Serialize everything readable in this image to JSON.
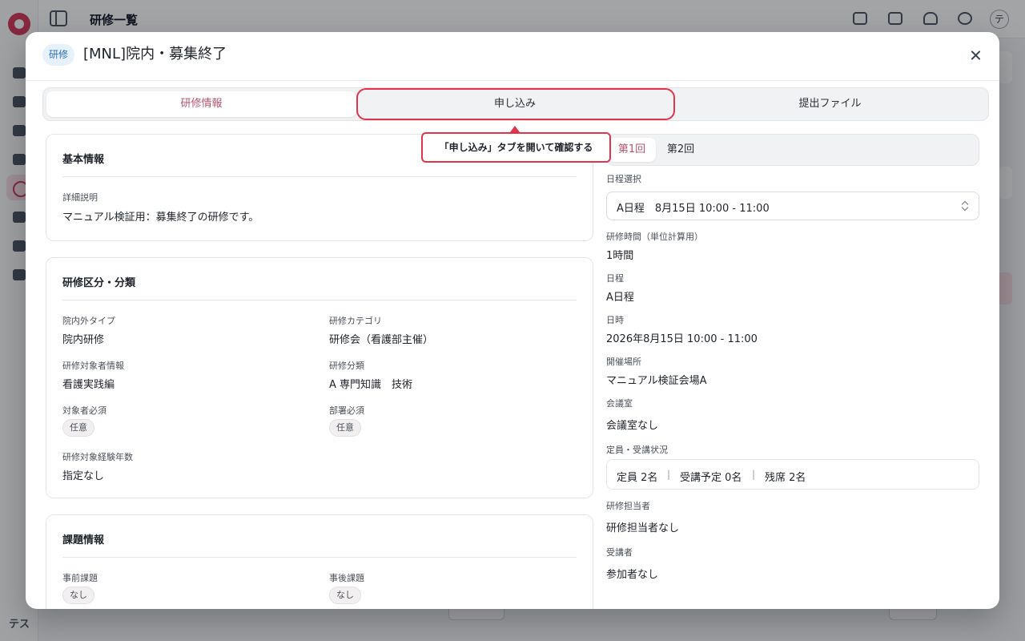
{
  "background": {
    "page_title": "研修一覧",
    "avatar_initial": "テ",
    "footer_label": "テス"
  },
  "modal": {
    "badge": "研修",
    "title": "[MNL]院内・募集終了",
    "tabs": [
      "研修情報",
      "申し込み",
      "提出ファイル"
    ],
    "active_tab": "研修情報",
    "tooltip": "「申し込み」タブを開いて確認する"
  },
  "basic_info": {
    "title": "基本情報",
    "description_label": "詳細説明",
    "description": "マニュアル検証用：募集終了の研修です。"
  },
  "classification": {
    "title": "研修区分・分類",
    "inout_type_label": "院内外タイプ",
    "inout_type": "院内研修",
    "category_label": "研修カテゴリ",
    "category": "研修会（看護部主催）",
    "target_info_label": "研修対象者情報",
    "target_info": "看護実践編",
    "classification_label": "研修分類",
    "classification": "A 専門知識　技術",
    "target_required_label": "対象者必須",
    "target_required": "任意",
    "dept_required_label": "部署必須",
    "dept_required": "任意",
    "experience_label": "研修対象経験年数",
    "experience": "指定なし"
  },
  "assignments": {
    "title": "課題情報",
    "pre_label": "事前課題",
    "pre": "なし",
    "post_label": "事後課題",
    "post": "なし"
  },
  "schedule": {
    "sessions": [
      "第1回",
      "第2回"
    ],
    "active_session": "第1回",
    "select_label": "日程選択",
    "select_value": "A日程　8月15日 10:00 - 11:00",
    "hours_label": "研修時間（単位計算用）",
    "hours": "1時間",
    "schedule_label": "日程",
    "schedule": "A日程",
    "datetime_label": "日時",
    "datetime": "2026年8月15日 10:00 - 11:00",
    "venue_label": "開催場所",
    "venue": "マニュアル検証会場A",
    "room_label": "会議室",
    "room": "会議室なし",
    "capacity_label": "定員・受講状況",
    "capacity": "定員 2名",
    "planned": "受講予定 0名",
    "remaining": "残席 2名",
    "separator": "|",
    "instructor_label": "研修担当者",
    "instructor": "研修担当者なし",
    "attendees_label": "受講者",
    "attendees": "参加者なし"
  },
  "colors": {
    "accent": "#b5546f",
    "highlight": "#e0344d",
    "badge_bg": "#e6f1fb",
    "badge_text": "#2a6fb5"
  }
}
